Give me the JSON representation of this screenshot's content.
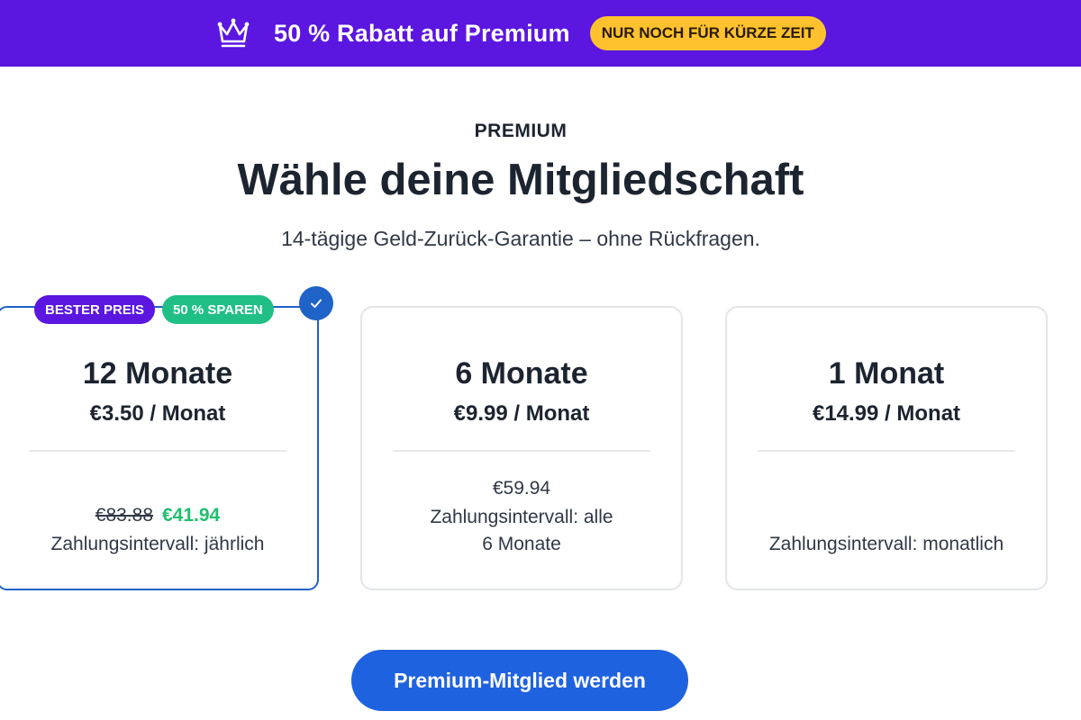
{
  "promo": {
    "icon": "crown-icon",
    "text": "50 % Rabatt auf Premium",
    "pill": "NUR NOCH FÜR KÜRZE ZEIT",
    "colors": {
      "bar": "#5b16e0",
      "pill": "#ffc22e"
    }
  },
  "header": {
    "eyebrow": "PREMIUM",
    "title": "Wähle deine Mitgliedschaft",
    "subtitle": "14-tägige Geld-Zurück-Garantie – ohne Rückfragen."
  },
  "plans": [
    {
      "name": "12 Monate",
      "rate": "€3.50 / Monat",
      "old_price": "€83.88",
      "new_price": "€41.94",
      "interval": "Zahlungsintervall: jährlich",
      "badges": [
        "BESTER PREIS",
        "50 % SPAREN"
      ],
      "selected": true
    },
    {
      "name": "6 Monate",
      "rate": "€9.99 / Monat",
      "total": "€59.94",
      "interval_line1": "Zahlungsintervall: alle",
      "interval_line2": "6 Monate",
      "selected": false
    },
    {
      "name": "1 Monat",
      "rate": "€14.99 / Monat",
      "interval": "Zahlungsintervall: monatlich",
      "selected": false
    }
  ],
  "cta": {
    "label": "Premium-Mitglied werden",
    "color": "#1f62e0"
  },
  "colors": {
    "selected_border": "#1f62c8",
    "savings_green": "#1fbf6e"
  }
}
